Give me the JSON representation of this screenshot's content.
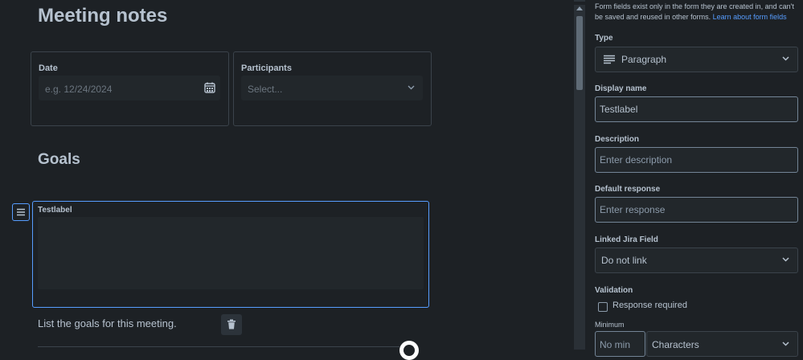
{
  "colors": {
    "background": "#1d2125",
    "accent": "#579dff",
    "field_bg": "#22272b",
    "text": "#b6c2cf"
  },
  "form": {
    "title": "Meeting notes",
    "date": {
      "label": "Date",
      "placeholder": "e.g. 12/24/2024",
      "icon": "calendar-icon"
    },
    "participants": {
      "label": "Participants",
      "placeholder": "Select...",
      "icon": "chevron-down-icon"
    },
    "section_title": "Goals",
    "selected_field": {
      "label": "Testlabel",
      "handle_icon": "hamburger-menu-icon"
    },
    "helper_text": "List the goals for this meeting.",
    "delete_icon": "trash-icon",
    "badge_icon": "assistant-badge-icon"
  },
  "panel": {
    "info_text": "Form fields exist only in the form they are created in, and can't be saved and reused in other forms.",
    "info_link": "Learn about form fields",
    "type": {
      "label": "Type",
      "value": "Paragraph",
      "icon": "paragraph-icon"
    },
    "display_name": {
      "label": "Display name",
      "value": "Testlabel"
    },
    "description": {
      "label": "Description",
      "placeholder": "Enter description"
    },
    "default_response": {
      "label": "Default response",
      "placeholder": "Enter response"
    },
    "linked_field": {
      "label": "Linked Jira Field",
      "value": "Do not link"
    },
    "validation": {
      "label": "Validation",
      "checkbox_label": "Response required",
      "checked": false
    },
    "minimum": {
      "label": "Minimum",
      "placeholder": "No min",
      "unit": "Characters"
    }
  }
}
